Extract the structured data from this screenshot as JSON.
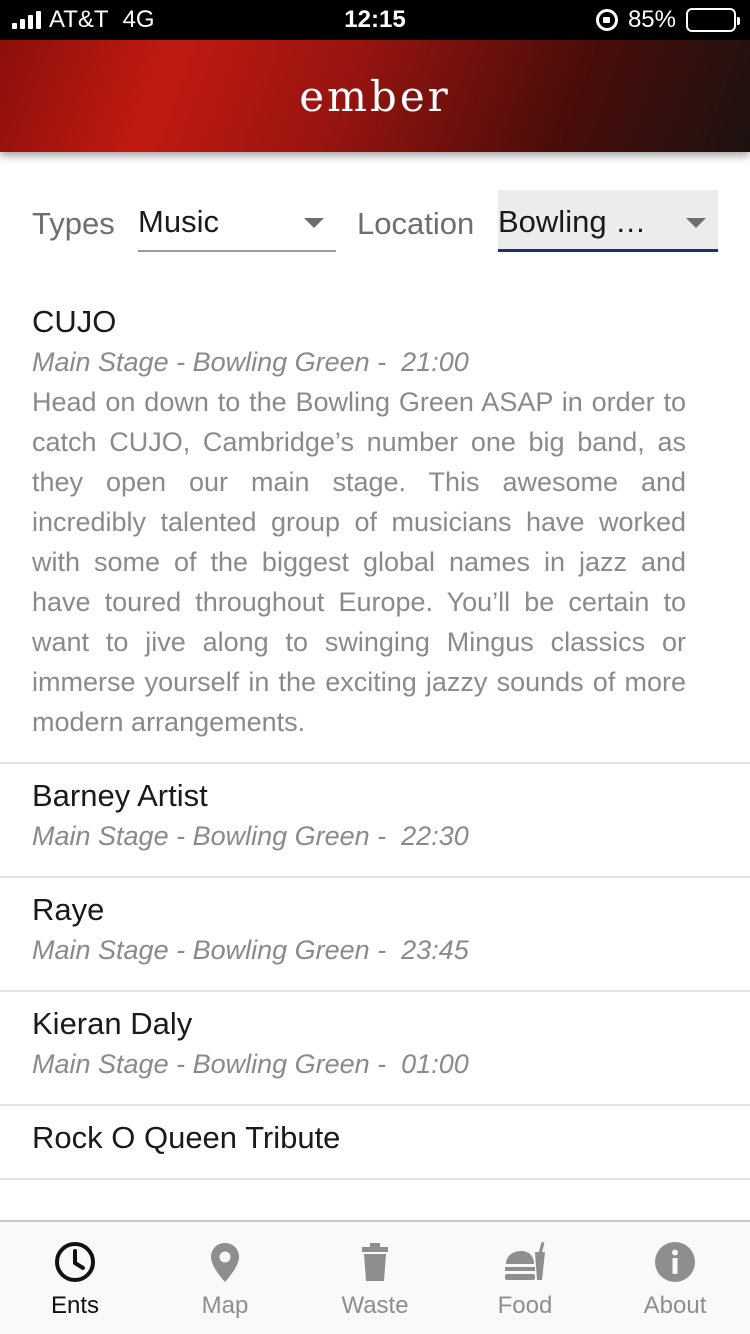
{
  "status_bar": {
    "carrier": "AT&T",
    "network": "4G",
    "time": "12:15",
    "battery_percent": "85%",
    "battery_level": 0.85
  },
  "header": {
    "title": "ember"
  },
  "filters": {
    "types_label": "Types",
    "types_value": "Music",
    "location_label": "Location",
    "location_value": "Bowling …"
  },
  "events": [
    {
      "title": "CUJO",
      "meta": "Main Stage - Bowling Green -  21:00",
      "description": "Head on down to the Bowling Green ASAP in order to catch CUJO, Cambridge’s number one big band, as they open our main stage. This awesome and incredibly talented group of musicians have worked with some of the biggest global names in jazz and have toured throughout Europe. You’ll be certain to want to jive along to swinging Mingus classics or immerse yourself in the exciting jazzy sounds of more modern arrangements."
    },
    {
      "title": "Barney Artist",
      "meta": "Main Stage - Bowling Green -  22:30"
    },
    {
      "title": "Raye",
      "meta": "Main Stage - Bowling Green -  23:45"
    },
    {
      "title": "Kieran Daly",
      "meta": "Main Stage - Bowling Green -  01:00"
    },
    {
      "title": "Rock O Queen Tribute",
      "meta": ""
    }
  ],
  "tabs": [
    {
      "label": "Ents",
      "icon": "clock-icon",
      "active": true
    },
    {
      "label": "Map",
      "icon": "map-pin-icon",
      "active": false
    },
    {
      "label": "Waste",
      "icon": "trash-icon",
      "active": false
    },
    {
      "label": "Food",
      "icon": "food-icon",
      "active": false
    },
    {
      "label": "About",
      "icon": "info-icon",
      "active": false
    }
  ],
  "colors": {
    "header_red": "#c01a12",
    "header_dark": "#1c1210",
    "focus_underline": "#1a2f7a",
    "muted_text": "#8a8a8a",
    "active_tab": "#111111",
    "inactive_tab": "#8e8e8e"
  }
}
